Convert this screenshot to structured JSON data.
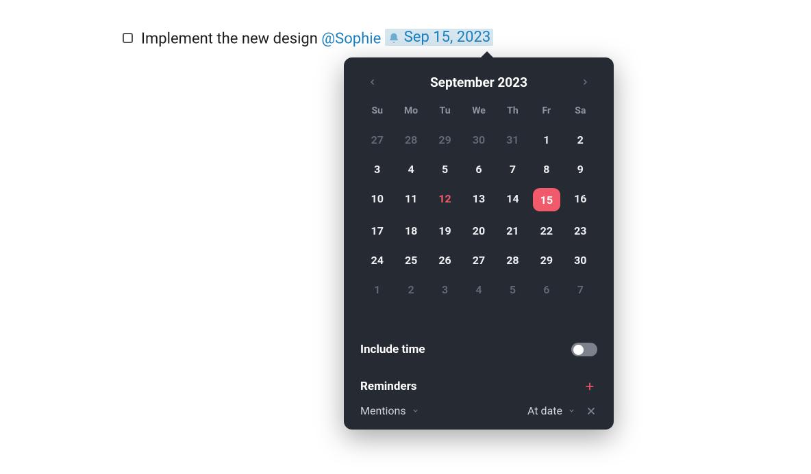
{
  "task": {
    "text": "Implement the new design",
    "mention": "@Sophie",
    "date_label": "Sep 15, 2023"
  },
  "calendar": {
    "title": "September 2023",
    "day_headers": [
      "Su",
      "Mo",
      "Tu",
      "We",
      "Th",
      "Fr",
      "Sa"
    ],
    "days": [
      {
        "n": "27",
        "out": true
      },
      {
        "n": "28",
        "out": true
      },
      {
        "n": "29",
        "out": true
      },
      {
        "n": "30",
        "out": true
      },
      {
        "n": "31",
        "out": true
      },
      {
        "n": "1"
      },
      {
        "n": "2"
      },
      {
        "n": "3"
      },
      {
        "n": "4"
      },
      {
        "n": "5"
      },
      {
        "n": "6"
      },
      {
        "n": "7"
      },
      {
        "n": "8"
      },
      {
        "n": "9"
      },
      {
        "n": "10"
      },
      {
        "n": "11"
      },
      {
        "n": "12",
        "today": true
      },
      {
        "n": "13"
      },
      {
        "n": "14"
      },
      {
        "n": "15",
        "sel": true
      },
      {
        "n": "16"
      },
      {
        "n": "17"
      },
      {
        "n": "18"
      },
      {
        "n": "19"
      },
      {
        "n": "20"
      },
      {
        "n": "21"
      },
      {
        "n": "22"
      },
      {
        "n": "23"
      },
      {
        "n": "24"
      },
      {
        "n": "25"
      },
      {
        "n": "26"
      },
      {
        "n": "27"
      },
      {
        "n": "28"
      },
      {
        "n": "29"
      },
      {
        "n": "30"
      },
      {
        "n": "1",
        "out": true
      },
      {
        "n": "2",
        "out": true
      },
      {
        "n": "3",
        "out": true
      },
      {
        "n": "4",
        "out": true
      },
      {
        "n": "5",
        "out": true
      },
      {
        "n": "6",
        "out": true
      },
      {
        "n": "7",
        "out": true
      }
    ]
  },
  "options": {
    "include_time_label": "Include time",
    "include_time_on": false,
    "reminders_label": "Reminders",
    "reminder_type": "Mentions",
    "reminder_when": "At date"
  }
}
